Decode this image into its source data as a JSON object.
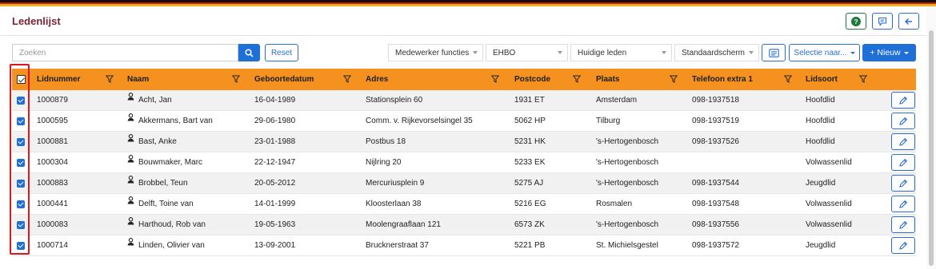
{
  "header": {
    "title": "Ledenlijst"
  },
  "toolbar": {
    "search_placeholder": "Zoeken",
    "reset_label": "Reset",
    "filters": [
      "Medewerker functies",
      "EHBO",
      "Huidige leden",
      "Standaardscherm"
    ],
    "selectie_label": "Selectie naar...",
    "nieuw_label": "+ Nieuw"
  },
  "columns": [
    "Lidnummer",
    "Naam",
    "Geboortedatum",
    "Adres",
    "Postcode",
    "Plaats",
    "Telefoon extra 1",
    "Lidsoort"
  ],
  "rows": [
    {
      "lidnummer": "1000879",
      "naam": "Acht, Jan",
      "geboortedatum": "16-04-1989",
      "adres": "Stationsplein 60",
      "postcode": "1931 ET",
      "plaats": "Amsterdam",
      "telefoon": "098-1937518",
      "lidsoort": "Hoofdlid"
    },
    {
      "lidnummer": "1000595",
      "naam": "Akkermans, Bart van",
      "geboortedatum": "29-06-1980",
      "adres": "Comm. v. Rijkevorselsingel 35",
      "postcode": "5062 HP",
      "plaats": "Tilburg",
      "telefoon": "098-1937519",
      "lidsoort": "Hoofdlid"
    },
    {
      "lidnummer": "1000881",
      "naam": "Bast, Anke",
      "geboortedatum": "23-01-1988",
      "adres": "Postbus 18",
      "postcode": "5231 HK",
      "plaats": "'s-Hertogenbosch",
      "telefoon": "098-1937526",
      "lidsoort": "Hoofdlid"
    },
    {
      "lidnummer": "1000304",
      "naam": "Bouwmaker, Marc",
      "geboortedatum": "22-12-1947",
      "adres": "Nijlring 20",
      "postcode": "5233 EK",
      "plaats": "'s-Hertogenbosch",
      "telefoon": "",
      "lidsoort": "Volwassenlid"
    },
    {
      "lidnummer": "1000883",
      "naam": "Brobbel, Teun",
      "geboortedatum": "20-05-2012",
      "adres": "Mercuriusplein 9",
      "postcode": "5275 AJ",
      "plaats": "'s-Hertogenbosch",
      "telefoon": "098-1937544",
      "lidsoort": "Jeugdlid"
    },
    {
      "lidnummer": "1000441",
      "naam": "Delft, Toine van",
      "geboortedatum": "14-01-1999",
      "adres": "Kloosterlaan 38",
      "postcode": "5216 EG",
      "plaats": "Rosmalen",
      "telefoon": "098-1937548",
      "lidsoort": "Volwassenlid"
    },
    {
      "lidnummer": "1000083",
      "naam": "Harthoud, Rob van",
      "geboortedatum": "19-05-1963",
      "adres": "Moolengraaflaan 121",
      "postcode": "6573 ZK",
      "plaats": "'s-Hertogenbosch",
      "telefoon": "098-1937556",
      "lidsoort": "Volwassenlid"
    },
    {
      "lidnummer": "1000714",
      "naam": "Linden, Olivier van",
      "geboortedatum": "13-09-2001",
      "adres": "Brucknerstraat 37",
      "postcode": "5221 PB",
      "plaats": "St. Michielsgestel",
      "telefoon": "098-1937572",
      "lidsoort": "Jeugdlid"
    }
  ],
  "colors": {
    "header_orange": "#f5911e",
    "accent_blue": "#1f6fd8",
    "title_red": "#7a2330",
    "highlight_red": "#e0161b"
  },
  "icons": [
    "help-icon",
    "comment-icon",
    "back-arrow-icon",
    "search-icon",
    "message-icon",
    "filter-icon",
    "person-icon",
    "pencil-icon"
  ]
}
